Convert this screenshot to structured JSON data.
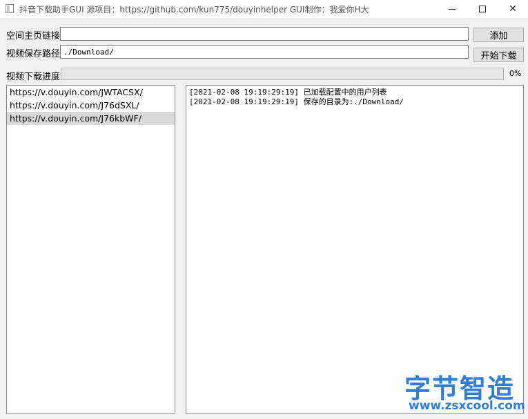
{
  "window": {
    "title": "抖音下载助手GUI 源项目：https://github.com/kun775/douyinhelper GUI制作：我爱你H大",
    "minimize_icon": "minimize-icon",
    "maximize_icon": "maximize-icon",
    "close_icon": "close-icon",
    "close_glyph": "✕"
  },
  "form": {
    "homepage_label": "空间主页链接",
    "homepage_value": "",
    "add_button": "添加",
    "save_path_label": "视频保存路径",
    "save_path_value": "./Download/",
    "start_button": "开始下载",
    "progress_label": "视频下载进度",
    "progress_percent": 0,
    "progress_text": "0%"
  },
  "user_list": {
    "items": [
      {
        "label": "https://v.douyin.com/JWTACSX/",
        "selected": false
      },
      {
        "label": "https://v.douyin.com/J76dSXL/",
        "selected": false
      },
      {
        "label": "https://v.douyin.com/J76kbWF/",
        "selected": true
      }
    ]
  },
  "log": {
    "lines": [
      "[2021-02-08 19:19:29:19] 已加载配置中的用户列表",
      "[2021-02-08 19:19:29:19] 保存的目录为:./Download/"
    ]
  },
  "watermark": {
    "title": "字节智造",
    "url": "www.zsxcool.com",
    "color": "#2f7fd8"
  }
}
